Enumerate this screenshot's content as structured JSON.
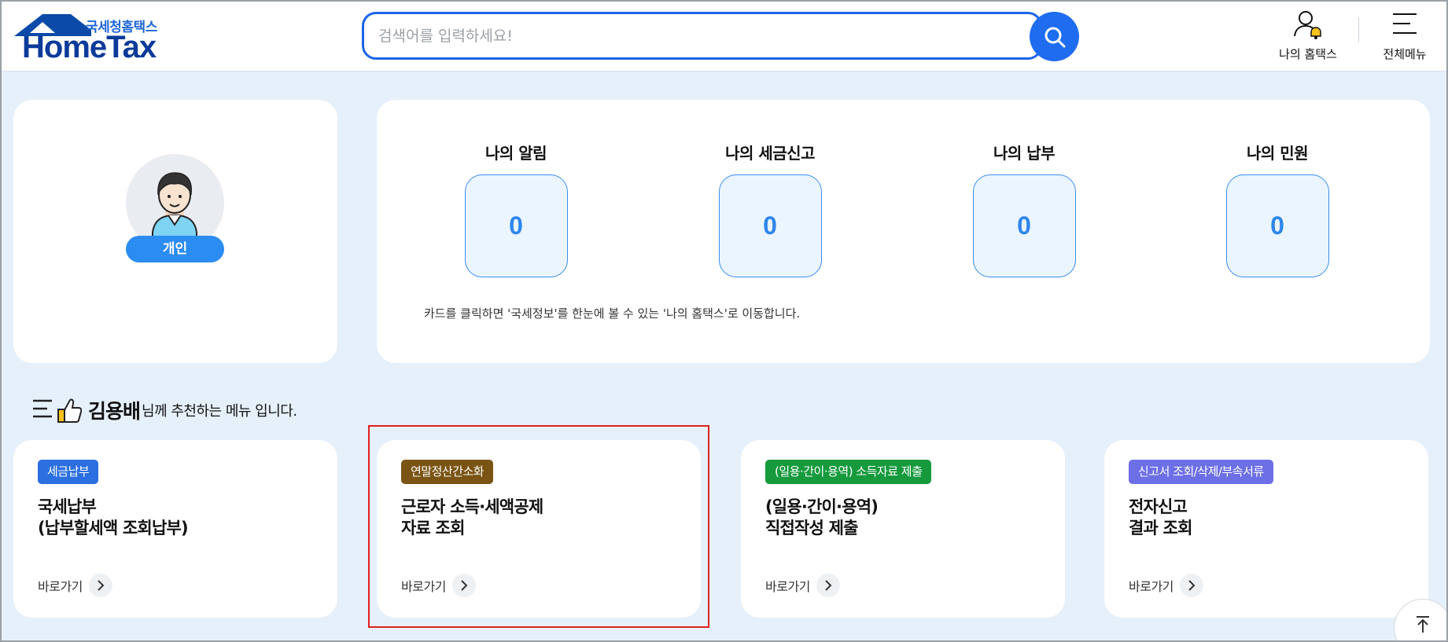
{
  "header": {
    "logo_sub": "국세청홈택스",
    "logo_main": "HomeTax",
    "search_placeholder": "검색어를 입력하세요!",
    "my_hometax_label": "나의 홈택스",
    "all_menu_label": "전체메뉴"
  },
  "profile": {
    "badge": "개인"
  },
  "status": {
    "items": [
      {
        "title": "나의 알림",
        "count": "0"
      },
      {
        "title": "나의 세금신고",
        "count": "0"
      },
      {
        "title": "나의 납부",
        "count": "0"
      },
      {
        "title": "나의 민원",
        "count": "0"
      }
    ],
    "hint": "카드를 클릭하면 '국세정보'를 한눈에 볼 수 있는 '나의 홈택스'로 이동합니다."
  },
  "recommend": {
    "name": "김용배",
    "suffix": "님께 추천하는 메뉴 입니다.",
    "cards": [
      {
        "tag": "세금납부",
        "tag_color": "#2b6fe0",
        "title": "국세납부\n(납부할세액 조회납부)",
        "goto": "바로가기"
      },
      {
        "tag": "연말정산간소화",
        "tag_color": "#7a5414",
        "title": "근로자 소득·세액공제\n자료 조회",
        "goto": "바로가기"
      },
      {
        "tag": "(일용·간이·용역) 소득자료 제출",
        "tag_color": "#169a3d",
        "title": "(일용·간이·용역)\n직접작성 제출",
        "goto": "바로가기"
      },
      {
        "tag": "신고서 조회/삭제/부속서류",
        "tag_color": "#6d6fe6",
        "title": "전자신고\n결과 조회",
        "goto": "바로가기"
      }
    ]
  },
  "colors": {
    "accent": "#1f6cf0",
    "background": "#e6f0fa",
    "highlight": "#e0201f"
  }
}
